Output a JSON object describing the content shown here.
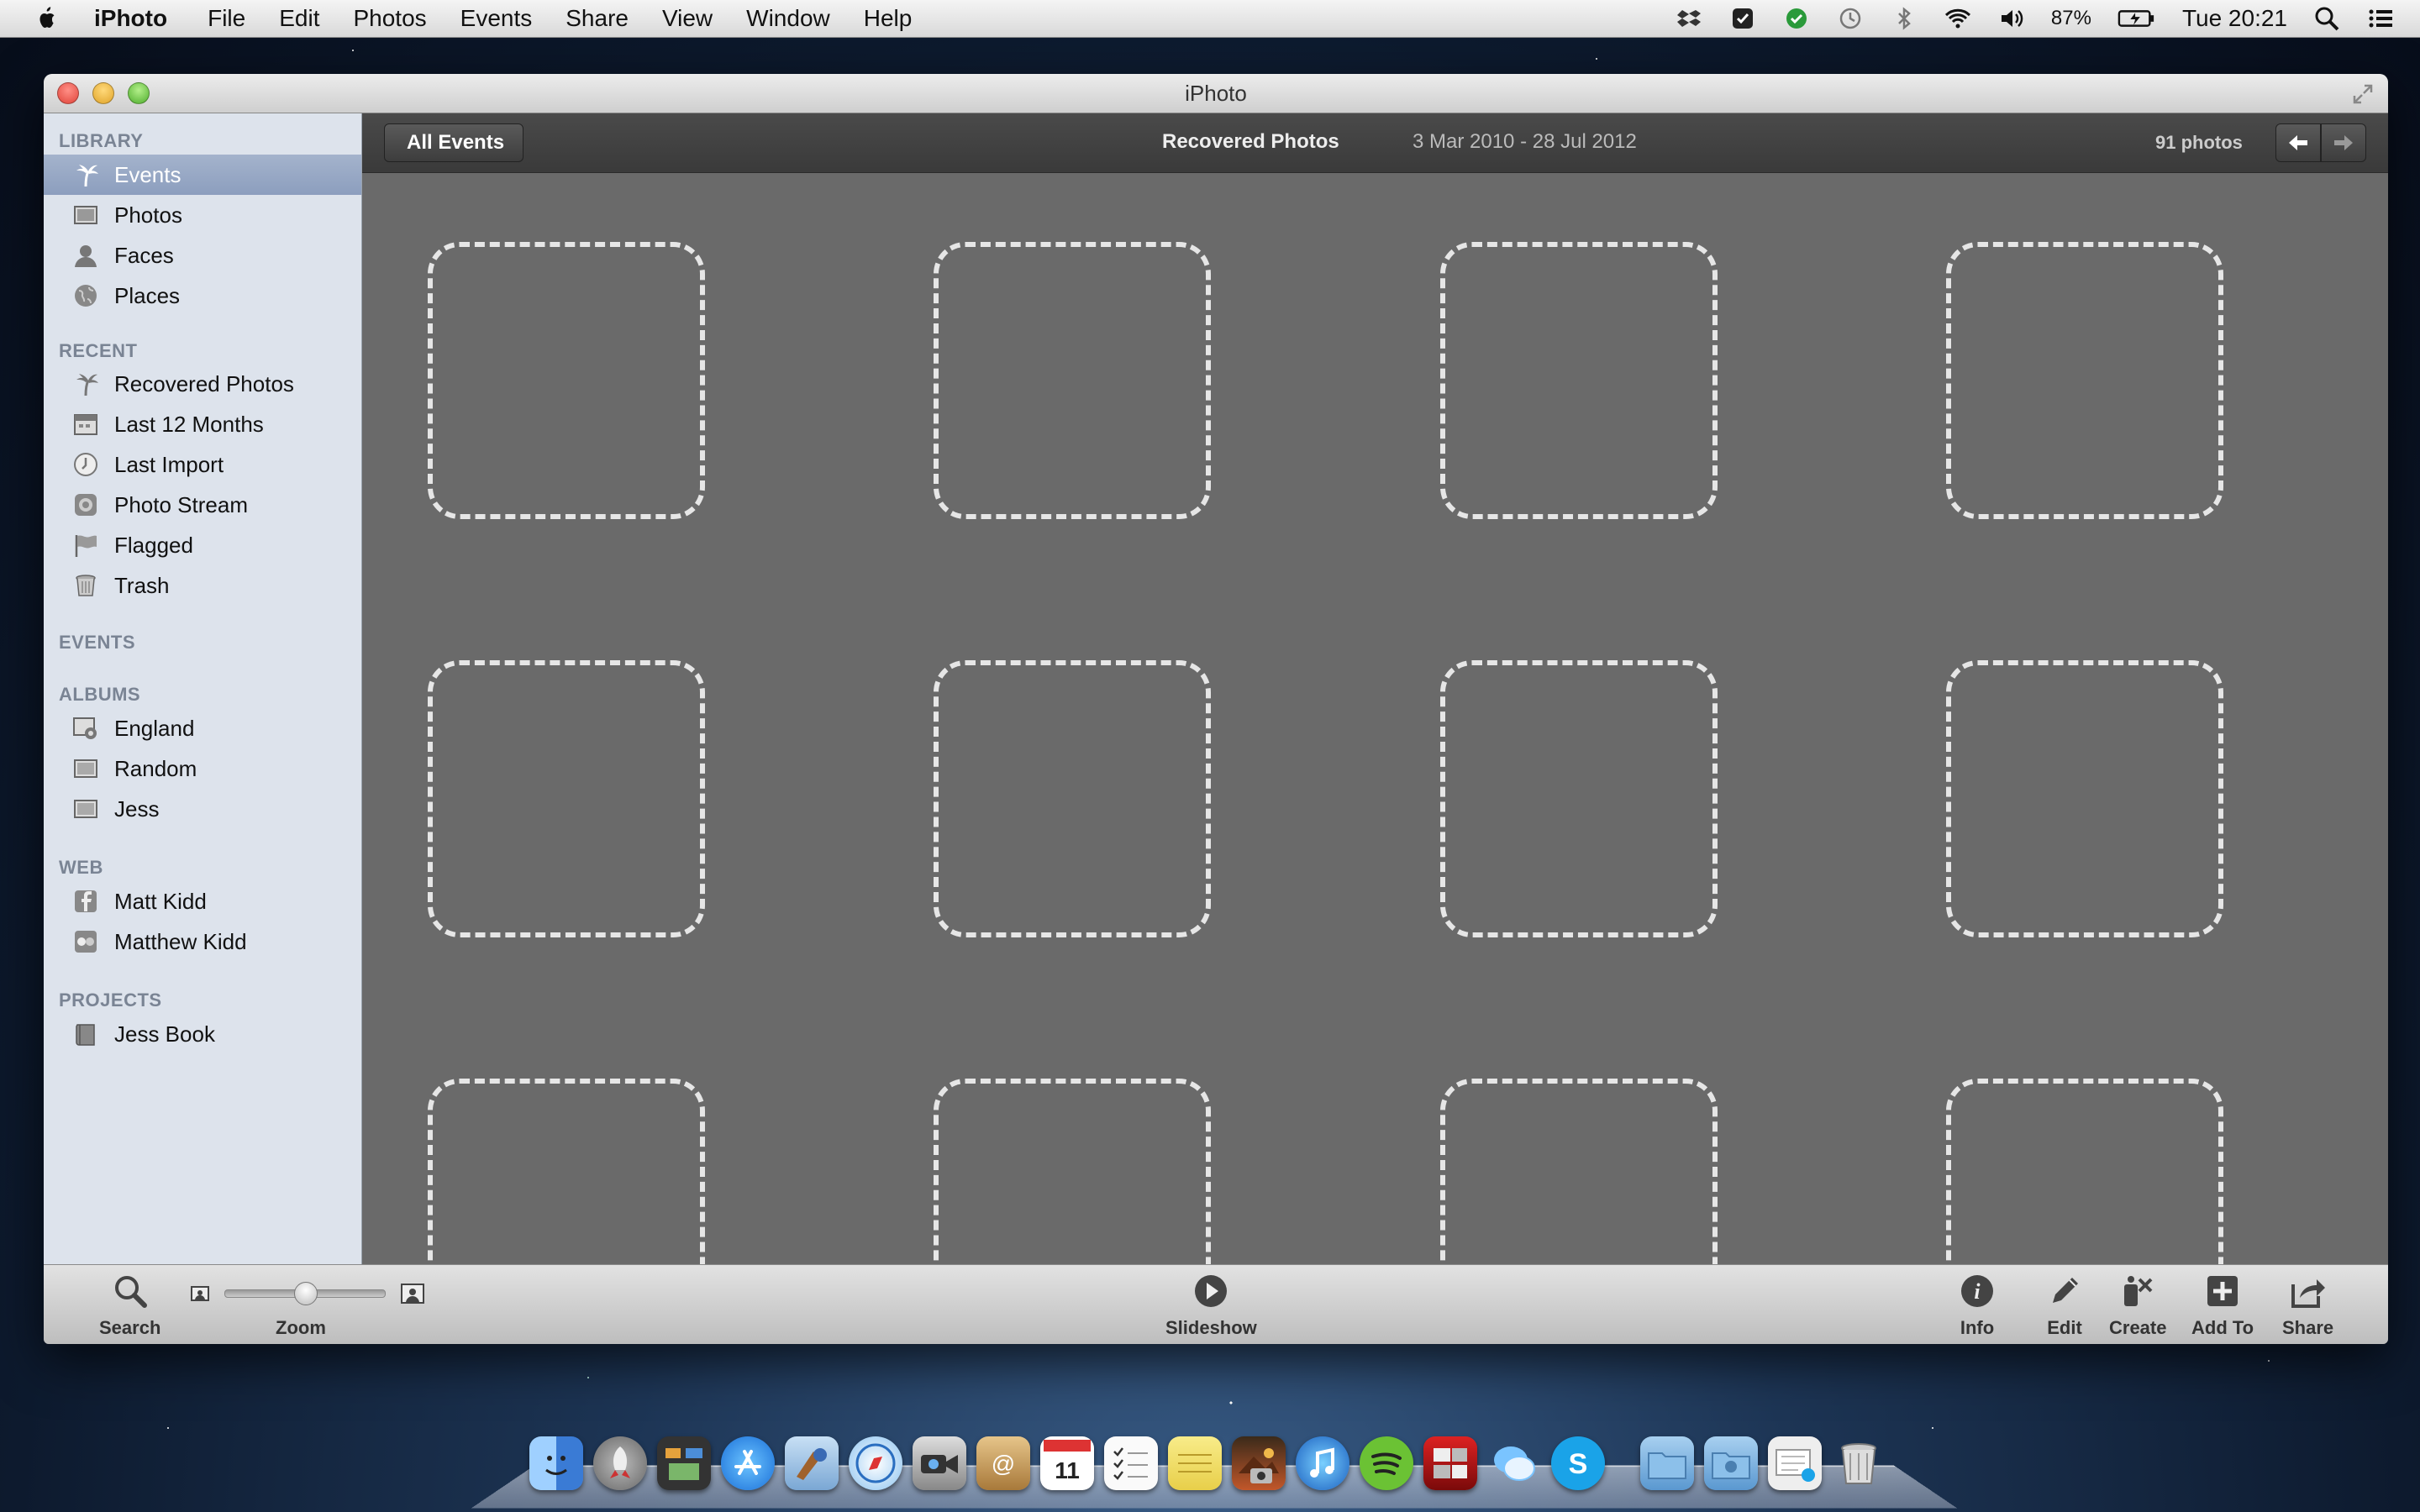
{
  "menubar": {
    "app_name": "iPhoto",
    "items": [
      "File",
      "Edit",
      "Photos",
      "Events",
      "Share",
      "View",
      "Window",
      "Help"
    ],
    "battery": "87%",
    "clock": "Tue 20:21"
  },
  "window": {
    "title": "iPhoto"
  },
  "sidebar": {
    "sections": {
      "library": "LIBRARY",
      "recent": "RECENT",
      "events": "EVENTS",
      "albums": "ALBUMS",
      "web": "WEB",
      "projects": "PROJECTS"
    },
    "library_items": [
      "Events",
      "Photos",
      "Faces",
      "Places"
    ],
    "recent_items": [
      "Recovered Photos",
      "Last 12 Months",
      "Last Import",
      "Photo Stream",
      "Flagged",
      "Trash"
    ],
    "album_items": [
      "England",
      "Random",
      "Jess"
    ],
    "web_items": [
      "Matt Kidd",
      "Matthew Kidd"
    ],
    "project_items": [
      "Jess Book"
    ]
  },
  "topbar": {
    "back_label": "All Events",
    "event_name": "Recovered Photos",
    "event_dates": "3 Mar 2010 - 28 Jul 2012",
    "photo_count": "91 photos"
  },
  "toolbar": {
    "search": "Search",
    "zoom": "Zoom",
    "zoom_level": 0.5,
    "slideshow": "Slideshow",
    "info": "Info",
    "edit": "Edit",
    "create": "Create",
    "add_to": "Add To",
    "share": "Share"
  },
  "dock": {
    "icons": [
      "finder-icon",
      "launchpad-icon",
      "mission-control-icon",
      "app-store-icon",
      "preview-icon",
      "safari-icon",
      "facetime-icon",
      "contacts-icon",
      "calendar-icon",
      "reminders-icon",
      "notes-icon",
      "iphoto-icon",
      "itunes-icon",
      "spotify-icon",
      "photo-booth-icon",
      "messages-icon",
      "skype-icon",
      "applications-folder-icon",
      "documents-folder-icon",
      "downloads-stack-icon",
      "trash-icon"
    ],
    "calendar_day": "11"
  }
}
